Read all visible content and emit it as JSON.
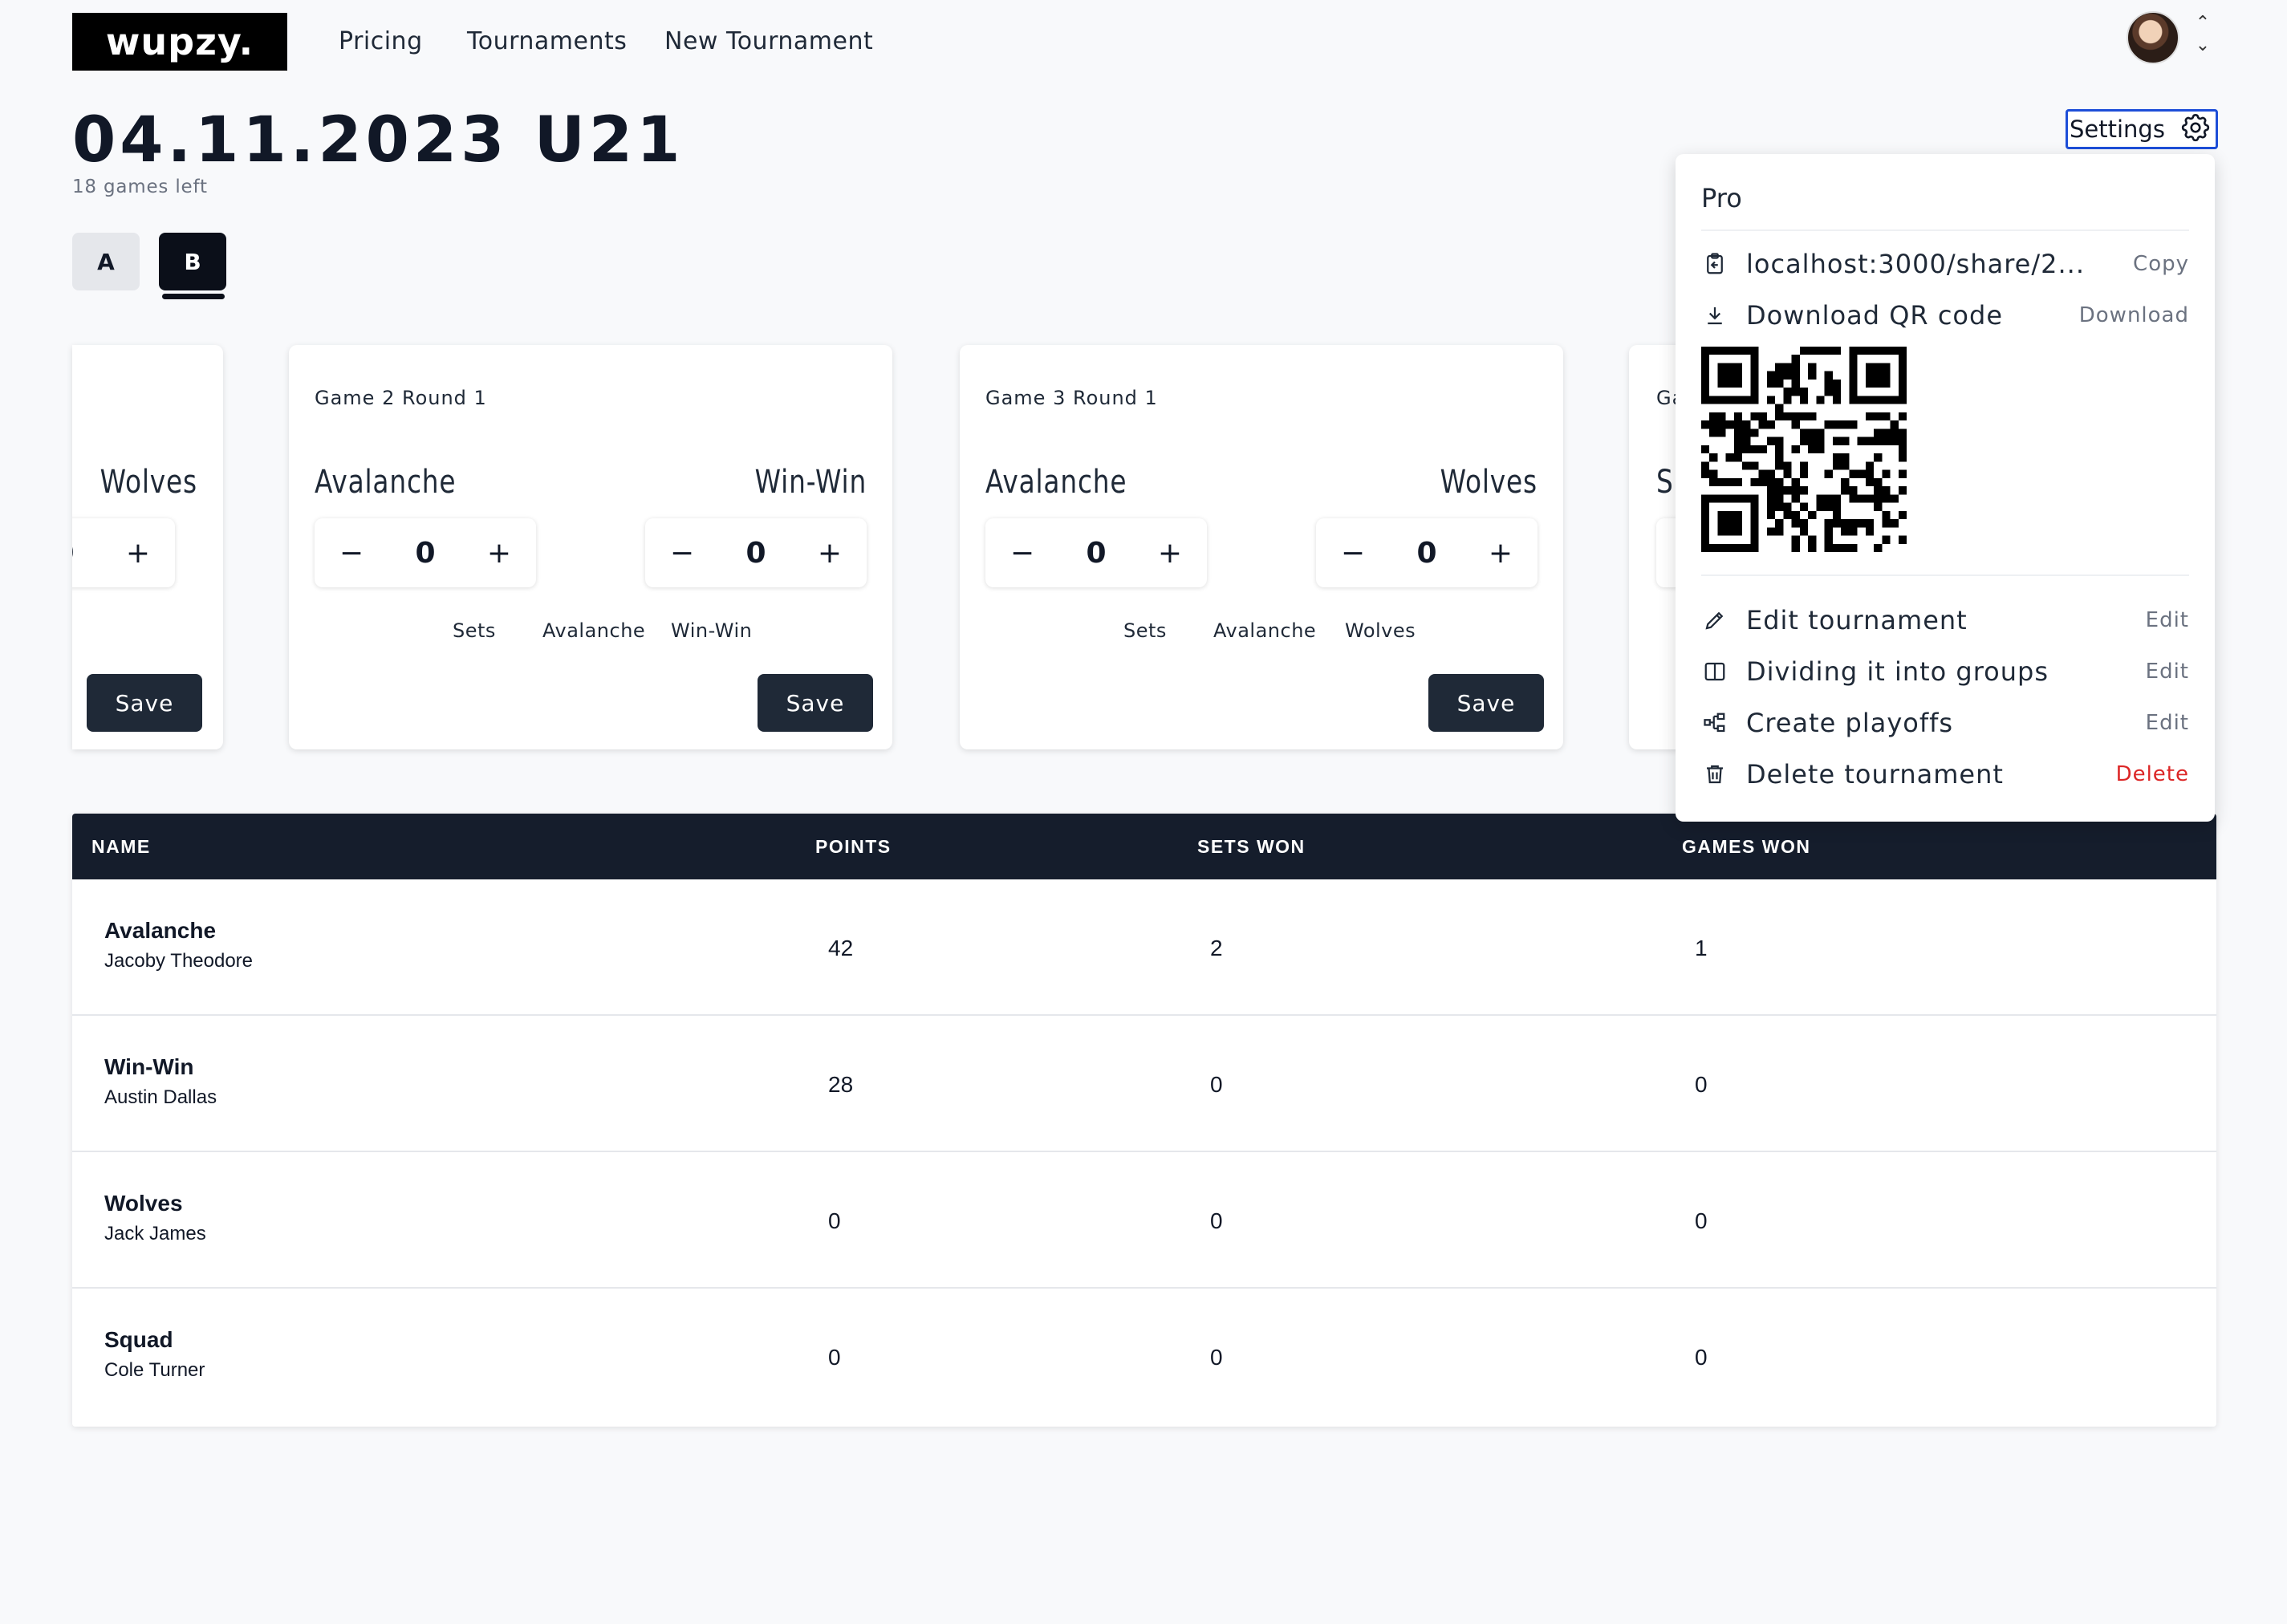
{
  "header": {
    "logo": "wupzy.",
    "nav": [
      "Pricing",
      "Tournaments",
      "New Tournament"
    ]
  },
  "tournament": {
    "title": "04.11.2023 U21",
    "games_left": "18 games left",
    "groups": [
      "A",
      "B"
    ],
    "active_group": "B"
  },
  "games": [
    {
      "title": "",
      "team1": "",
      "team2": "Wolves",
      "score1": "",
      "score2": "0",
      "sets_label": "",
      "sets_team1": "",
      "sets_team2": "",
      "save": "Save"
    },
    {
      "title": "Game 2 Round 1",
      "team1": "Avalanche",
      "team2": "Win-Win",
      "score1": "0",
      "score2": "0",
      "sets_label": "Sets",
      "sets_team1": "Avalanche",
      "sets_team2": "Win-Win",
      "save": "Save"
    },
    {
      "title": "Game 3 Round 1",
      "team1": "Avalanche",
      "team2": "Wolves",
      "score1": "0",
      "score2": "0",
      "sets_label": "Sets",
      "sets_team1": "Avalanche",
      "sets_team2": "Wolves",
      "save": "Save"
    },
    {
      "title": "Ga",
      "team1": "S",
      "team2": "",
      "score1": "",
      "score2": "",
      "sets_label": "",
      "sets_team1": "",
      "sets_team2": "",
      "save": ""
    }
  ],
  "standings": {
    "columns": [
      "NAME",
      "POINTS",
      "SETS WON",
      "GAMES WON"
    ],
    "rows": [
      {
        "team": "Avalanche",
        "player": "Jacoby Theodore",
        "points": "42",
        "sets_won": "2",
        "games_won": "1"
      },
      {
        "team": "Win-Win",
        "player": "Austin Dallas",
        "points": "28",
        "sets_won": "0",
        "games_won": "0"
      },
      {
        "team": "Wolves",
        "player": "Jack James",
        "points": "0",
        "sets_won": "0",
        "games_won": "0"
      },
      {
        "team": "Squad",
        "player": "Cole Turner",
        "points": "0",
        "sets_won": "0",
        "games_won": "0"
      }
    ]
  },
  "settings": {
    "button_label": "Settings",
    "plan": "Pro",
    "share_link": "localhost:3000/share/2...",
    "copy_action": "Copy",
    "qr_label": "Download QR code",
    "qr_action": "Download",
    "items": [
      {
        "label": "Edit tournament",
        "action": "Edit",
        "icon": "pencil-icon"
      },
      {
        "label": "Dividing it into groups",
        "action": "Edit",
        "icon": "columns-icon"
      },
      {
        "label": "Create playoffs",
        "action": "Edit",
        "icon": "bracket-icon"
      },
      {
        "label": "Delete tournament",
        "action": "Delete",
        "icon": "trash-icon"
      }
    ],
    "colors": {
      "danger": "#dc2626",
      "focus": "#1d4ed8"
    }
  }
}
